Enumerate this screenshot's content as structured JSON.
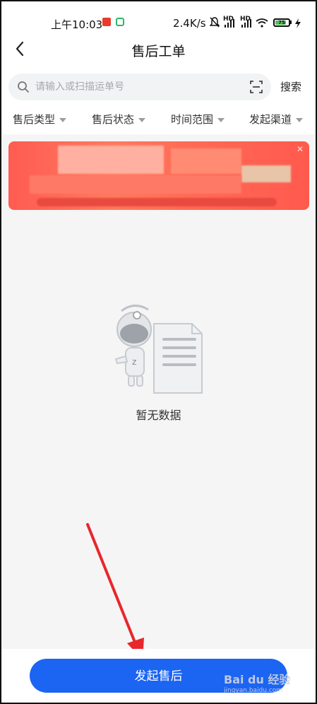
{
  "status_bar": {
    "time": "上午10:03",
    "net_speed": "2.4K/s",
    "hd1": "HD",
    "hd2": "HD",
    "battery_level": "75",
    "battery_fraction": 0.75
  },
  "header": {
    "title": "售后工单"
  },
  "search": {
    "placeholder": "请输入或扫描运单号",
    "button_label": "搜索"
  },
  "filters": [
    {
      "label": "售后类型"
    },
    {
      "label": "售后状态"
    },
    {
      "label": "时间范围"
    },
    {
      "label": "发起渠道"
    }
  ],
  "empty_state": {
    "text": "暂无数据"
  },
  "footer": {
    "submit_label": "发起售后"
  },
  "watermark": {
    "logo": "Bai du 经验",
    "sub": "jingyan.baidu.com"
  },
  "colors": {
    "primary": "#1c64f2",
    "banner": "#ff5b52",
    "annotation_arrow": "#e8272c"
  }
}
